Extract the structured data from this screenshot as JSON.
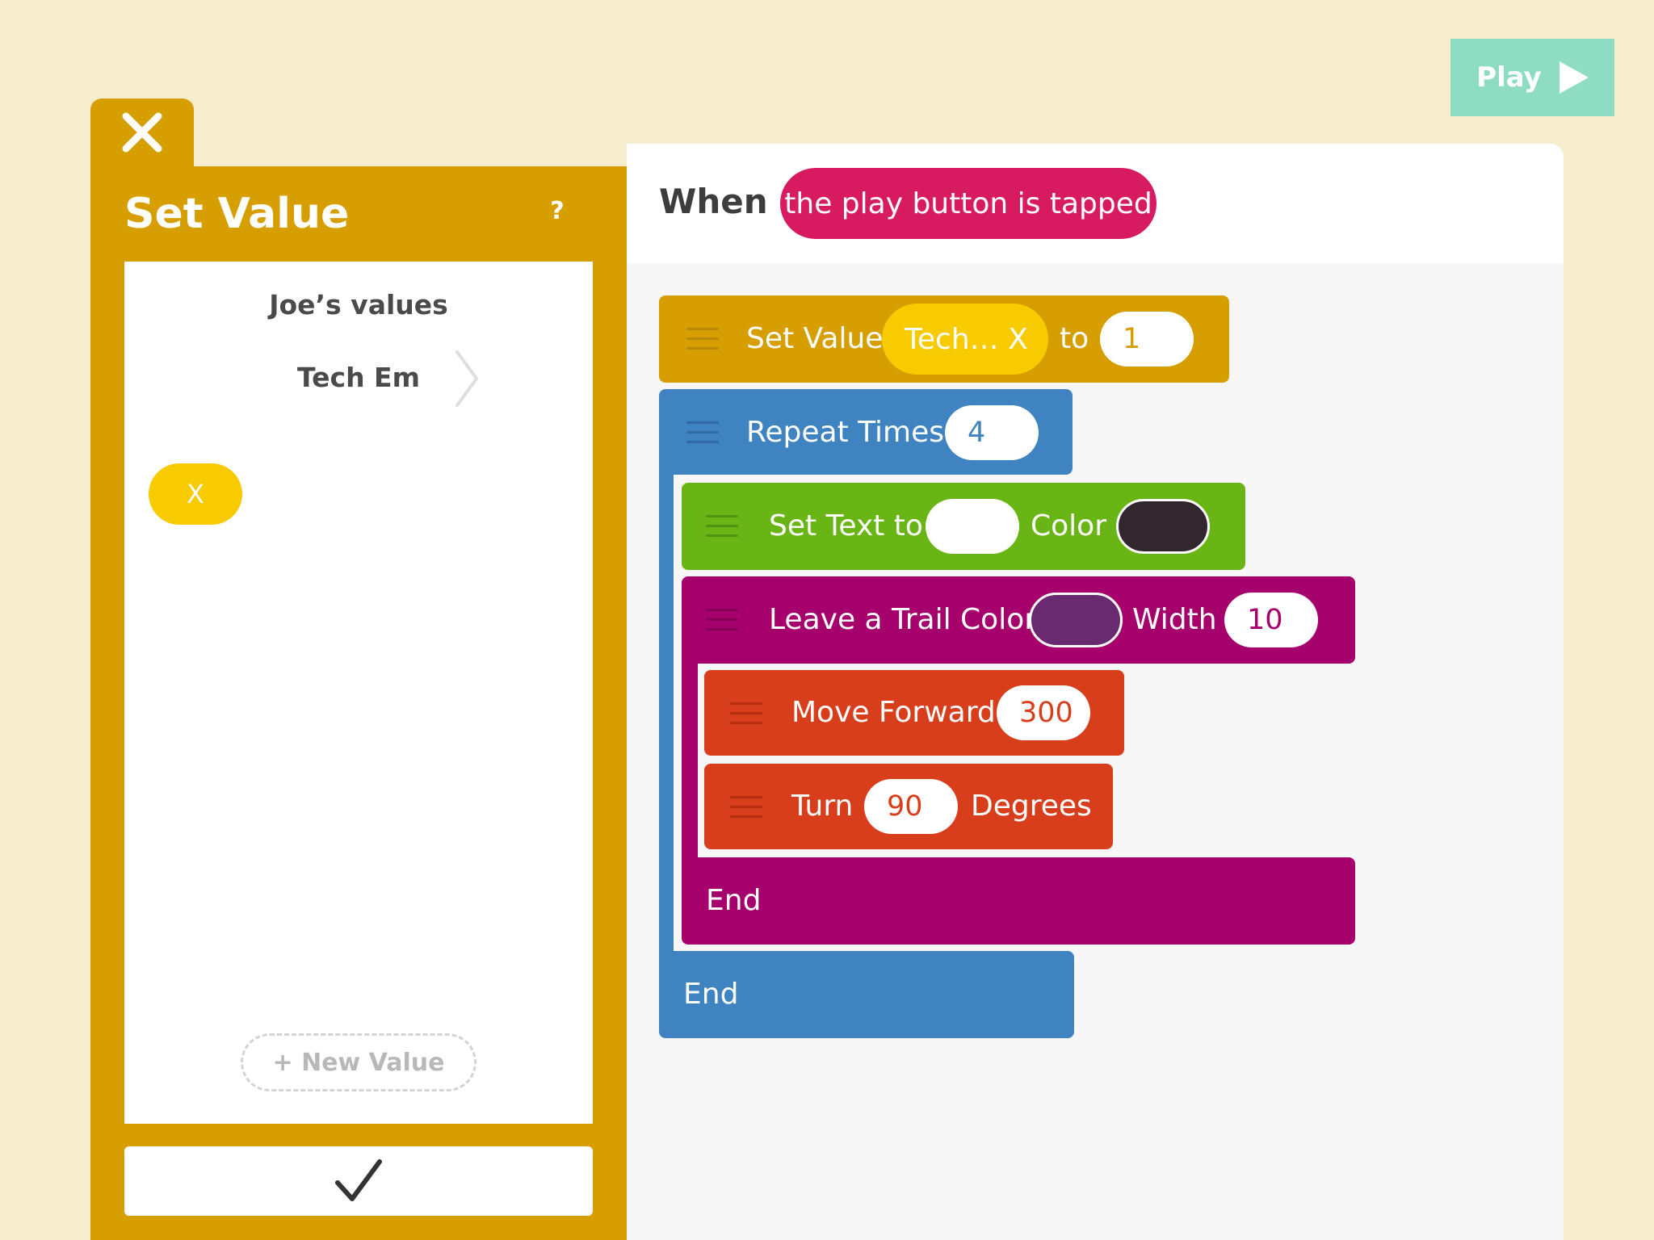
{
  "play_button": {
    "label": "Play"
  },
  "panel": {
    "title": "Set Value",
    "help_label": "?",
    "owner_heading": "Joe’s values",
    "group_name": "Tech Em",
    "variables": [
      {
        "name": "X"
      }
    ],
    "new_value_label": "+ New Value"
  },
  "editor": {
    "when_label": "When",
    "trigger": "the play button is tapped",
    "blocks": {
      "set_value": {
        "label": "Set Value",
        "variable": "Tech… X",
        "to_label": "to",
        "value": "1",
        "color": "#d79e00"
      },
      "repeat": {
        "label": "Repeat  Times",
        "times": "4",
        "end_label": "End",
        "color": "#3f83c1"
      },
      "set_text": {
        "label": "Set Text  to",
        "text": "",
        "color_label": "Color",
        "color": "#6ab516",
        "text_color": "#33272f"
      },
      "trail": {
        "label": "Leave a Trail  Color",
        "width_label": "Width",
        "width": "10",
        "end_label": "End",
        "color": "#a5006b",
        "trail_color": "#6a2a70"
      },
      "move": {
        "label": "Move Forward",
        "distance": "300",
        "color": "#d83e1c"
      },
      "turn": {
        "label": "Turn",
        "degrees": "90",
        "unit_label": "Degrees",
        "color": "#d83e1c"
      }
    }
  }
}
